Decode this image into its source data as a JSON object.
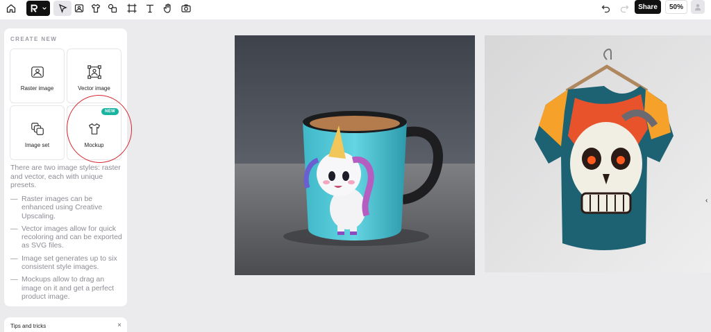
{
  "toolbar": {
    "tools": [
      "home-icon",
      "logo-menu",
      "select-icon",
      "image-icon",
      "tshirt-icon",
      "image-set-icon",
      "crop-icon",
      "text-icon",
      "hand-icon",
      "camera-icon"
    ],
    "share_label": "Share",
    "zoom_label": "50%"
  },
  "panel": {
    "title": "CREATE NEW",
    "cards": [
      {
        "label": "Raster image",
        "icon": "raster-image-icon"
      },
      {
        "label": "Vector image",
        "icon": "vector-image-icon"
      },
      {
        "label": "Image set",
        "icon": "image-set-icon"
      },
      {
        "label": "Mockup",
        "icon": "tshirt-icon",
        "badge": "NEW"
      }
    ],
    "intro": "There are two image styles: raster and vector, each with unique presets.",
    "bullets": [
      {
        "dash": "—",
        "text": "Raster images can be enhanced using Creative Upscaling."
      },
      {
        "dash": "—",
        "text": "Vector images allow for quick recoloring and can be exported as SVG files."
      },
      {
        "dash": "—",
        "text": "Image set generates up to six consistent style images."
      },
      {
        "dash": "—",
        "text": "Mockups allow to drag an image on it and get a perfect product image."
      }
    ]
  },
  "tips": {
    "label": "Tips and tricks",
    "close": "×"
  },
  "canvas": {
    "edge_chevron": "‹"
  }
}
